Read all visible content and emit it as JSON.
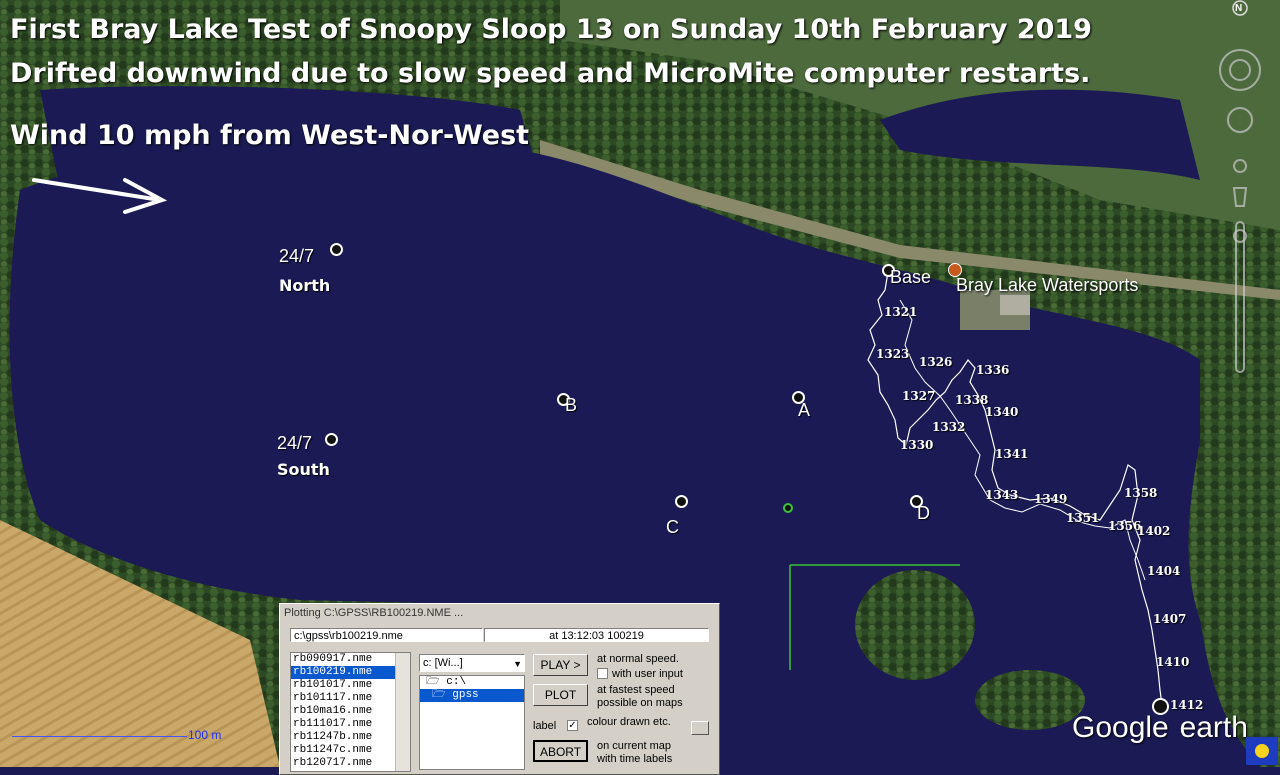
{
  "titles": {
    "line1": "First Bray Lake Test of Snoopy Sloop 13 on Sunday 10th February 2019",
    "line2": "Drifted downwind due to slow speed and MicroMite computer restarts.",
    "line3": "Wind 10 mph from West-Nor-West"
  },
  "markers": {
    "north": {
      "code": "24/7",
      "name": "North"
    },
    "south": {
      "code": "24/7",
      "name": "South"
    },
    "waypoints": [
      "A",
      "B",
      "C",
      "D",
      "Base"
    ]
  },
  "place_name": "Bray Lake Watersports",
  "track_labels": [
    "1321",
    "1323",
    "1326",
    "1327",
    "1336",
    "1338",
    "1340",
    "1332",
    "1330",
    "1341",
    "1343",
    "1349",
    "1351",
    "1358",
    "1356",
    "1402",
    "1404",
    "1407",
    "1410",
    "1412"
  ],
  "compass_letter": "N",
  "scale_label": "100 m",
  "google_earth": {
    "google": "Google",
    "earth": "earth"
  },
  "dialog": {
    "title": "Plotting C:\\GPSS\\RB100219.NME ...",
    "path": "c:\\gpss\\rb100219.nme",
    "time": "at 13:12:03 100219",
    "files": [
      "rb090917.nme",
      "rb100219.nme",
      "rb101017.nme",
      "rb101117.nme",
      "rb10ma16.nme",
      "rb111017.nme",
      "rb11247b.nme",
      "rb11247c.nme",
      "rb120717.nme"
    ],
    "selected_file": "rb100219.nme",
    "drive": "c: [Wi...]",
    "folders": [
      "c:\\",
      "gpss"
    ],
    "buttons": {
      "play": "PLAY >",
      "plot": "PLOT",
      "abort": "ABORT"
    },
    "notes": {
      "normal": "at normal speed.",
      "user_input": "with user input",
      "fastest": "at fastest speed",
      "possible": "possible on maps",
      "label": "label",
      "colour": "colour drawn etc.",
      "current": "on current map",
      "time_labels": "with time labels"
    }
  }
}
